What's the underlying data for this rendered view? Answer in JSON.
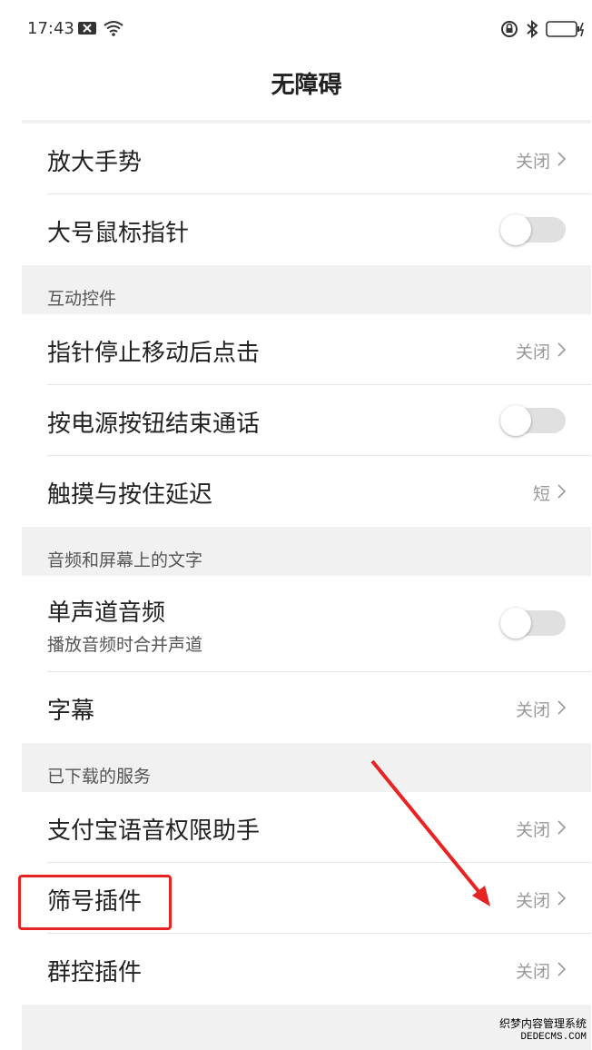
{
  "status": {
    "time": "17:43"
  },
  "header": {
    "title": "无障碍"
  },
  "rows": {
    "magnify": {
      "label": "放大手势",
      "value": "关闭"
    },
    "large_pointer": {
      "label": "大号鼠标指针"
    },
    "section_interaction": "互动控件",
    "click_after_stop": {
      "label": "指针停止移动后点击",
      "value": "关闭"
    },
    "power_end_call": {
      "label": "按电源按钮结束通话"
    },
    "touch_hold_delay": {
      "label": "触摸与按住延迟",
      "value": "短"
    },
    "section_audio_text": "音频和屏幕上的文字",
    "mono_audio": {
      "label": "单声道音频",
      "sublabel": "播放音频时合并声道"
    },
    "captions": {
      "label": "字幕",
      "value": "关闭"
    },
    "section_downloaded": "已下载的服务",
    "alipay_voice": {
      "label": "支付宝语音权限助手",
      "value": "关闭"
    },
    "number_filter": {
      "label": "筛号插件",
      "value": "关闭"
    },
    "group_control": {
      "label": "群控插件",
      "value": "关闭"
    }
  },
  "watermark": {
    "line1": "织梦内容管理系统",
    "line2": "DEDECMS.COM"
  }
}
